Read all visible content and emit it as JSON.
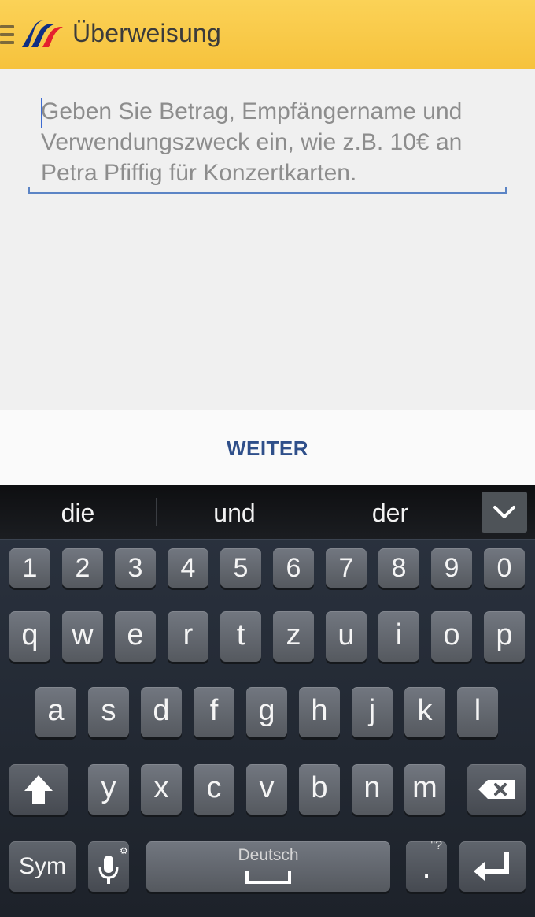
{
  "header": {
    "title": "Überweisung"
  },
  "input": {
    "placeholder": "Geben Sie Betrag, Empfängername und Verwendungszweck ein, wie z.B. 10€ an Petra Pfiffig für Konzertkarten."
  },
  "bottom": {
    "weiter_label": "WEITER"
  },
  "keyboard": {
    "suggestions": [
      "die",
      "und",
      "der"
    ],
    "numbers": [
      "1",
      "2",
      "3",
      "4",
      "5",
      "6",
      "7",
      "8",
      "9",
      "0"
    ],
    "row1": [
      "q",
      "w",
      "e",
      "r",
      "t",
      "z",
      "u",
      "i",
      "o",
      "p"
    ],
    "row2": [
      "a",
      "s",
      "d",
      "f",
      "g",
      "h",
      "j",
      "k",
      "l"
    ],
    "row3": [
      "y",
      "x",
      "c",
      "v",
      "b",
      "n",
      "m"
    ],
    "sym_label": "Sym",
    "space_label": "Deutsch",
    "mic_hint": "⚙",
    "period_label": ".",
    "period_hint": "\"?"
  }
}
